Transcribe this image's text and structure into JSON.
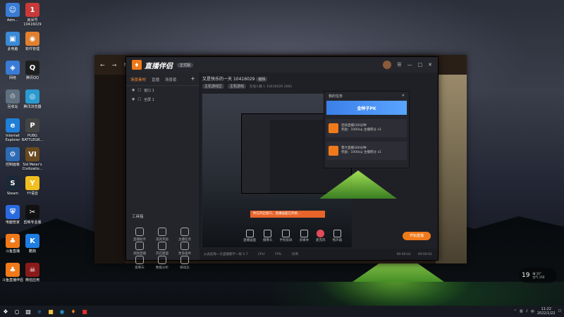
{
  "desktop": {
    "icons": [
      {
        "label": "Adm...",
        "glyph": "☺",
        "color": "#3a7bd5"
      },
      {
        "label": "房间号 10416029",
        "glyph": "1",
        "color": "#c83a3a"
      },
      {
        "label": "此电脑",
        "glyph": "▣",
        "color": "#3a8ad5"
      },
      {
        "label": "软件管理",
        "glyph": "◉",
        "color": "#e08030"
      },
      {
        "label": "网络",
        "glyph": "◈",
        "color": "#3a7bd5"
      },
      {
        "label": "腾讯QQ",
        "glyph": "Q",
        "color": "#1e1e1e"
      },
      {
        "label": "回收站",
        "glyph": "♲",
        "color": "#607080"
      },
      {
        "label": "腾讯浏览器",
        "glyph": "◎",
        "color": "#2a9ad0"
      },
      {
        "label": "Internet Explorer",
        "glyph": "e",
        "color": "#1f7fd8"
      },
      {
        "label": "PUBG BATTLEGR...",
        "glyph": "P",
        "color": "#444"
      },
      {
        "label": "控制面板",
        "glyph": "⚙",
        "color": "#2d6bb5"
      },
      {
        "label": "Sid Meier's Civilizatio...",
        "glyph": "VI",
        "color": "#6a4a20"
      },
      {
        "label": "Steam",
        "glyph": "S",
        "color": "#1b2838"
      },
      {
        "label": "YY语音",
        "glyph": "Y",
        "color": "#f0c020"
      },
      {
        "label": "电脑管家",
        "glyph": "⛨",
        "color": "#2a6ae0"
      },
      {
        "label": "剪映专业版",
        "glyph": "✂",
        "color": "#111"
      },
      {
        "label": "斗鱼直播",
        "glyph": "♣",
        "color": "#f07a1a"
      },
      {
        "label": "酷狗",
        "glyph": "K",
        "color": "#1e7de0"
      },
      {
        "label": "斗鱼直播伴侣",
        "glyph": "♣",
        "color": "#f07a1a"
      },
      {
        "label": "微信应用",
        "glyph": "☠",
        "color": "#8a1a1a"
      }
    ]
  },
  "app": {
    "logo_text": "直播伴侣",
    "badge": "正式版",
    "scene_tabs": [
      "场景素材",
      "直播",
      "场景套"
    ],
    "scene_items": [
      "窗口 1",
      "全屏 1"
    ],
    "tools_title": "工具箱",
    "tools": [
      "直播助手",
      "道具奖励",
      "主播任务",
      "视频直播",
      "开启版面",
      "更多插件",
      "爱聊天",
      "数据分析",
      "微动态"
    ],
    "room_title": "又是快乐的一天",
    "room_id": "10416029",
    "room_badge": "编辑",
    "tags": [
      "主机游戏区",
      "主机游戏"
    ],
    "room_info": [
      "在线人数 1",
      "10416029",
      "2691"
    ],
    "task_panel_title": "我的任务",
    "banner_text": "金种子PK",
    "tasks": [
      {
        "title": "连续直播100分钟",
        "sub": "奖励：1000xp  主播积分 x1"
      },
      {
        "title": "累计直播300分钟",
        "sub": "奖励：1000xp  主播积分 x1"
      }
    ],
    "toast": "你已开启窗口，直播画面已开始...",
    "toolbar": [
      "直播画面",
      "摄像头",
      "手机投屏",
      "多媒体",
      "麦克风",
      "扬声器"
    ],
    "go_live": "开始直播",
    "status_left": "从此起每一天直播都不一样 5.7",
    "status_stats": [
      "CPU:",
      "FPS:",
      "码率:"
    ],
    "time1": "00:00:02",
    "time2": "00:00:01"
  },
  "weather": {
    "temp": "19",
    "line1": "晴 10°",
    "line2": "空气 150"
  },
  "taskbar": {
    "time": "11:22",
    "date": "2022/1/22",
    "lang": "中"
  }
}
